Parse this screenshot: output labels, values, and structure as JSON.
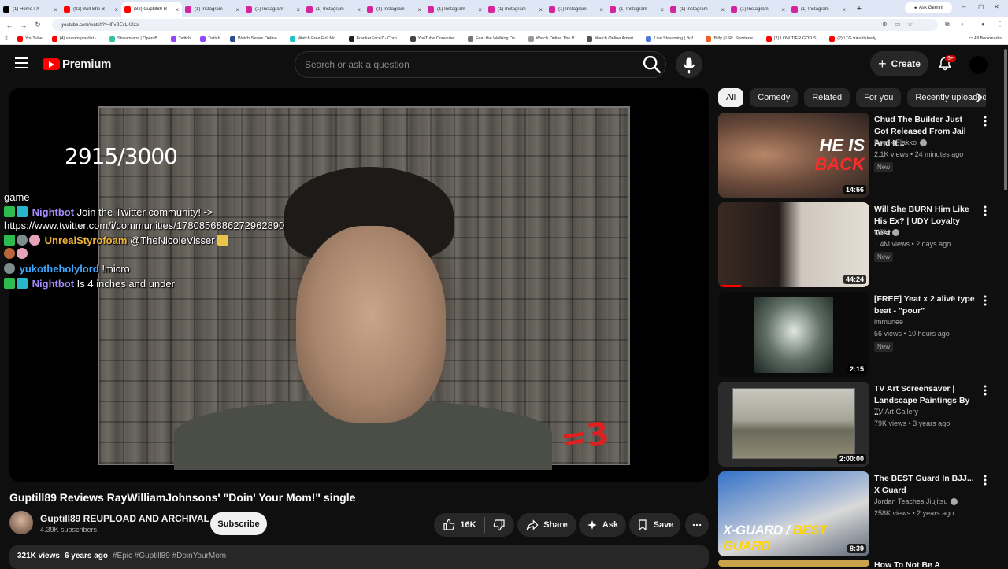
{
  "browser": {
    "tabs": [
      {
        "title": "(1) Home / X",
        "fav": "#000000"
      },
      {
        "title": "(82) Will She B",
        "fav": "#ff0000"
      },
      {
        "title": "(82) Guptill89 R",
        "fav": "#ff0000",
        "active": true
      },
      {
        "title": "(1) Instagram",
        "fav": "#d6249f"
      },
      {
        "title": "(1) Instagram",
        "fav": "#d6249f"
      },
      {
        "title": "(1) Instagram",
        "fav": "#d6249f"
      },
      {
        "title": "(1) Instagram",
        "fav": "#d6249f"
      },
      {
        "title": "(1) Instagram",
        "fav": "#d6249f"
      },
      {
        "title": "(1) Instagram",
        "fav": "#d6249f"
      },
      {
        "title": "(1) Instagram",
        "fav": "#d6249f"
      },
      {
        "title": "(1) Instagram",
        "fav": "#d6249f"
      },
      {
        "title": "(1) Instagram",
        "fav": "#d6249f"
      },
      {
        "title": "(1) Instagram",
        "fav": "#d6249f"
      },
      {
        "title": "(1) Instagram",
        "fav": "#d6249f"
      }
    ],
    "ask_gemini": "Ask Gemini",
    "url": "youtube.com/watch?v=lFvBEvLKXzs",
    "bookmarks": [
      {
        "label": "YouTube",
        "fav": "#ff0000"
      },
      {
        "label": "(4) stream playlist -...",
        "fav": "#ff0000"
      },
      {
        "label": "Streamlabs | Open B...",
        "fav": "#31c3a2"
      },
      {
        "label": "Twitch",
        "fav": "#9146ff"
      },
      {
        "label": "Twitch",
        "fav": "#9146ff"
      },
      {
        "label": "Watch Series Online...",
        "fav": "#2a4d8f"
      },
      {
        "label": "Watch Free Full Mo...",
        "fav": "#20c4c4"
      },
      {
        "label": "FrankerFaceZ - Chro...",
        "fav": "#222222"
      },
      {
        "label": "YouTube Converter...",
        "fav": "#444444"
      },
      {
        "label": "Fear the Walking De...",
        "fav": "#777777"
      },
      {
        "label": "Watch Online The P...",
        "fav": "#999999"
      },
      {
        "label": "Watch Online Ameri...",
        "fav": "#555555"
      },
      {
        "label": "Live Streaming | Buf...",
        "fav": "#4a7ae0"
      },
      {
        "label": "Bitly | URL Shortene...",
        "fav": "#ee6123"
      },
      {
        "label": "(2) LOW TIER GOD S...",
        "fav": "#ff0000"
      },
      {
        "label": "(2) LTG tries itslowly...",
        "fav": "#ff0000"
      }
    ],
    "all_bookmarks": "All Bookmarks"
  },
  "header": {
    "logo_text": "Premium",
    "search_placeholder": "Search or ask a question",
    "create_label": "Create",
    "notification_badge": "9+"
  },
  "video": {
    "counter": "2915/3000",
    "corner_text": "=3",
    "chat": {
      "first_line": "game",
      "messages": [
        {
          "user": "Nightbot",
          "text": "Join the Twitter community! -> https://www.twitter.com/i/communities/1780856886272962890"
        },
        {
          "user": "UnrealStyrofoam",
          "text": "@TheNicoleVisser"
        },
        {
          "user": "yukotheholylord",
          "text": "!micro"
        },
        {
          "user": "Nightbot",
          "text": "Is 4 inches and under"
        }
      ]
    },
    "title": "Guptill89 Reviews RayWilliamJohnsons' \"Doin' Your Mom!\" single",
    "channel": "Guptill89 REUPLOAD AND ARCHIVAL",
    "subscribers": "4.39K subscribers",
    "subscribe_label": "Subscribe",
    "likes": "16K",
    "share_label": "Share",
    "ask_label": "Ask",
    "save_label": "Save",
    "views": "321K views",
    "age": "6 years ago",
    "tags": "#Epic #Guptill89 #DoinYourMom"
  },
  "chips": [
    "All",
    "Comedy",
    "Related",
    "For you",
    "Recently uploaded"
  ],
  "recommendations": [
    {
      "title": "Chud The Builder Just Got Released From Jail And It...",
      "channel": "Poetik Flakko",
      "verified": true,
      "meta": "2.1K views • 24 minutes ago",
      "new": "New",
      "duration": "14:56"
    },
    {
      "title": "Will She BURN Him Like His Ex? | UDY Loyalty Test",
      "channel": "UDY",
      "verified": true,
      "meta": "1.4M views • 2 days ago",
      "new": "New",
      "duration": "44:24",
      "progress": 0.15
    },
    {
      "title": "[FREE] Yeat x 2 alivë type beat - \"pour\"",
      "channel": "immunee",
      "verified": false,
      "meta": "56 views • 10 hours ago",
      "new": "New",
      "duration": "2:15"
    },
    {
      "title": "TV Art Screensaver | Landscape Paintings By ...",
      "channel": "TV Art Gallery",
      "verified": false,
      "meta": "79K views • 3 years ago",
      "new": "",
      "duration": "2:00:00"
    },
    {
      "title": "The BEST Guard In BJJ... X Guard",
      "channel": "Jordan Teaches Jiujitsu",
      "verified": true,
      "meta": "258K views • 2 years ago",
      "new": "",
      "duration": "8:39"
    },
    {
      "title": "How To Not Be A Pedophile",
      "channel": "",
      "verified": false,
      "meta": "",
      "new": "",
      "duration": ""
    }
  ],
  "thumb_text": {
    "he_is": "HE IS",
    "back": "BACK",
    "xguard_a": "X-GUARD / ",
    "xguard_b": "BEST GUARD"
  }
}
